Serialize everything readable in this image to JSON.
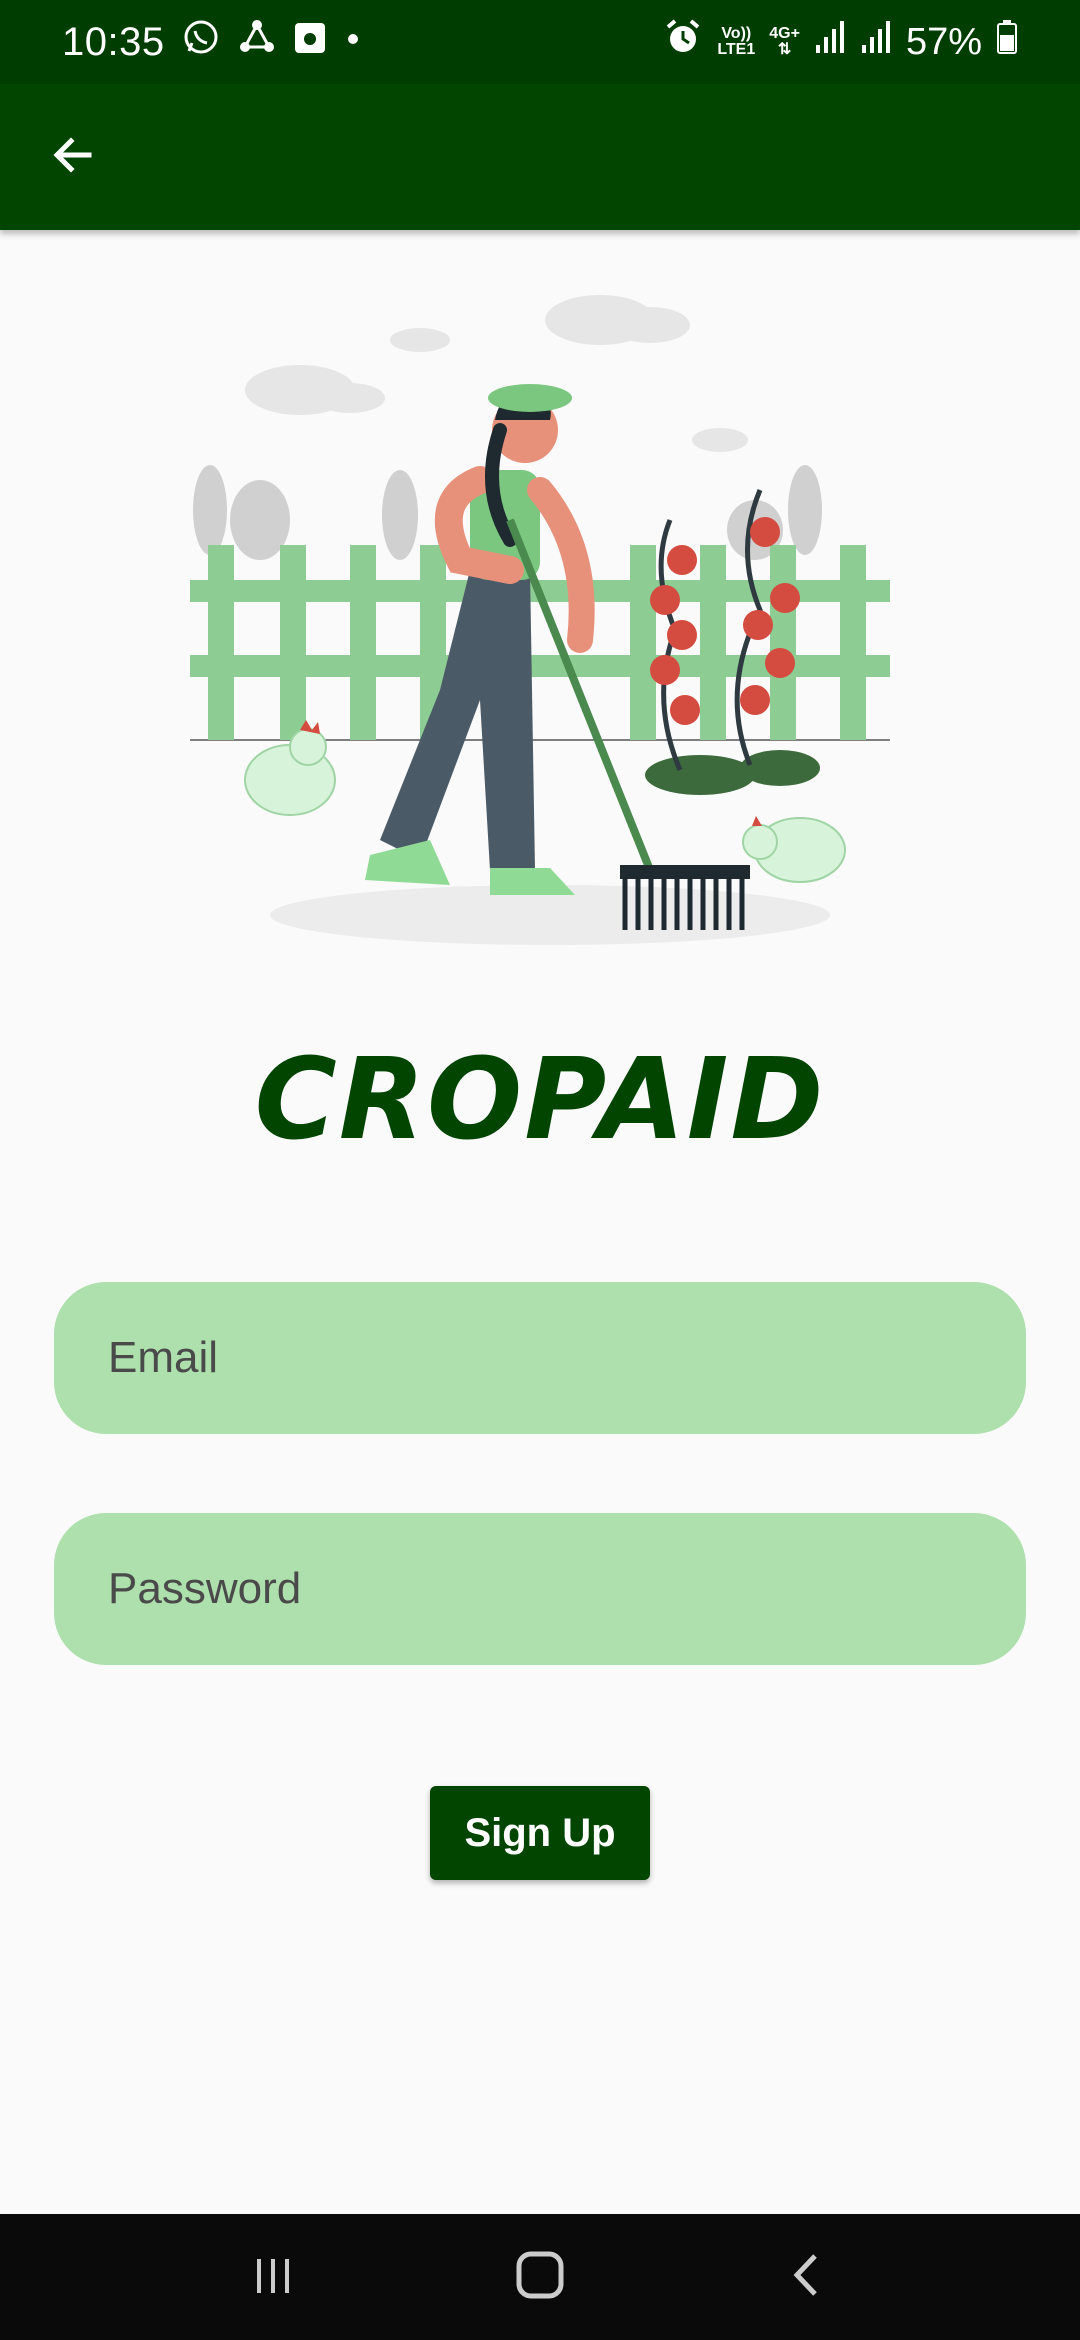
{
  "status_bar": {
    "time": "10:35",
    "battery": "57%",
    "network_top": "Vo))",
    "network_bottom": "LTE1",
    "network_type": "4G+",
    "left_icons": [
      "whatsapp-icon",
      "share-icon",
      "calendar-icon",
      "dot-icon"
    ],
    "right_icons": [
      "alarm-icon",
      "signal-icon",
      "signal-icon",
      "battery-icon"
    ]
  },
  "app_bar": {
    "back_icon": "arrow-left-icon"
  },
  "brand": {
    "title": "CROPAID"
  },
  "form": {
    "email_placeholder": "Email",
    "password_placeholder": "Password",
    "signup_label": "Sign Up"
  },
  "nav_bar": {
    "icons": [
      "recents-icon",
      "home-icon",
      "back-icon"
    ]
  },
  "colors": {
    "primary": "#014501",
    "status_bar": "#003d00",
    "field_bg": "#ade0ad",
    "background": "#fafafa"
  }
}
